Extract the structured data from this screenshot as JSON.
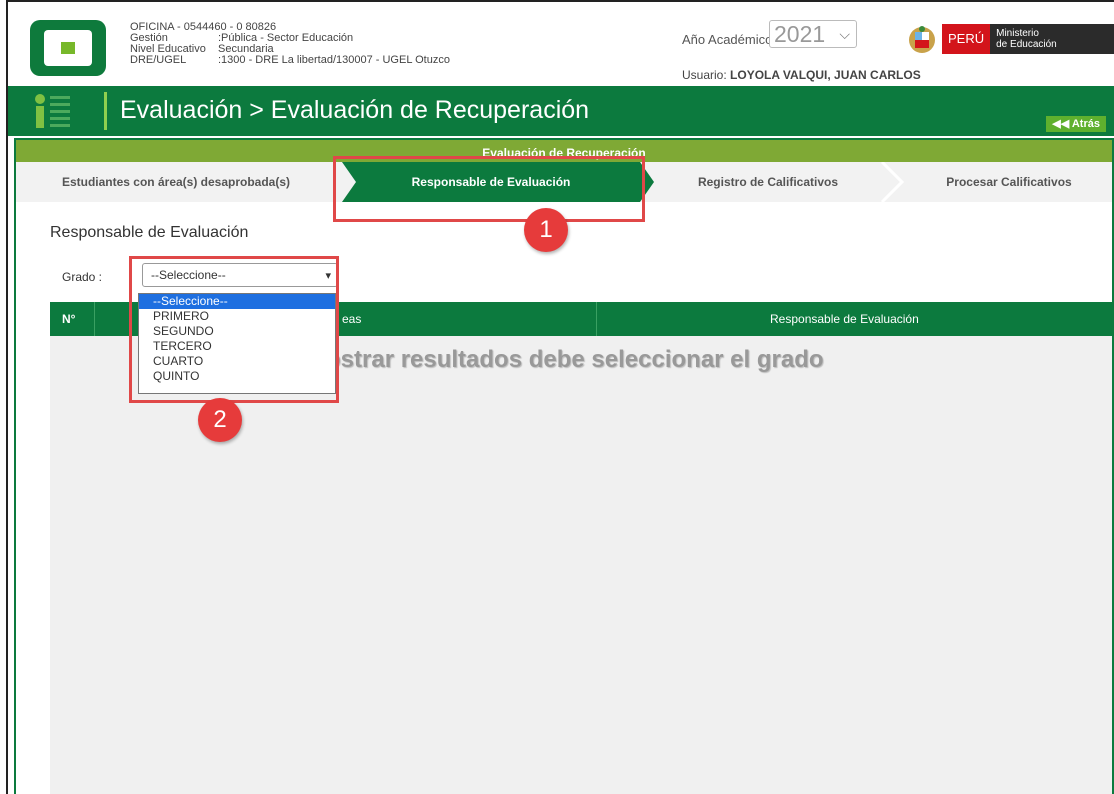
{
  "header": {
    "office": "OFICINA - 0544460 - 0  80826",
    "rows": [
      {
        "k": "Gestión",
        "v": ":Pública - Sector Educación"
      },
      {
        "k": "Nivel Educativo",
        "v": "Secundaria"
      },
      {
        "k": "DRE/UGEL",
        "v": ":1300 - DRE La libertad/130007 - UGEL Otuzco"
      }
    ],
    "year_label": "Año Académico",
    "year_value": "2021",
    "user_label": "Usuario:",
    "user_name": "LOYOLA VALQUI, JUAN CARLOS",
    "peru": "PERÚ",
    "ministerio_1": "Ministerio",
    "ministerio_2": "de Educación"
  },
  "titlebar": {
    "title": "Evaluación > Evaluación de Recuperación",
    "back": "◀◀ Atrás"
  },
  "section": {
    "title": "Evaluación de Recuperación"
  },
  "steps": [
    {
      "label": "Estudiantes con área(s) desaprobada(s)"
    },
    {
      "label": "Responsable de Evaluación"
    },
    {
      "label": "Registro de Calificativos"
    },
    {
      "label": "Procesar Calificativos"
    }
  ],
  "form": {
    "heading": "Responsable de Evaluación",
    "grado_label": "Grado  :",
    "grado_value": "--Seleccione--",
    "options": [
      "--Seleccione--",
      "PRIMERO",
      "SEGUNDO",
      "TERCERO",
      "CUARTO",
      "QUINTO"
    ]
  },
  "table": {
    "col_n": "N°",
    "col_areas": "eas",
    "col_resp": "Responsable de Evaluación",
    "empty_message": "ostrar resultados debe seleccionar el grado"
  },
  "annotations": {
    "badge1": "1",
    "badge2": "2",
    "color": "#e04848"
  },
  "colors": {
    "brand_green": "#0c7a3e",
    "light_green": "#7fa935",
    "select_blue": "#1e6fe0"
  }
}
